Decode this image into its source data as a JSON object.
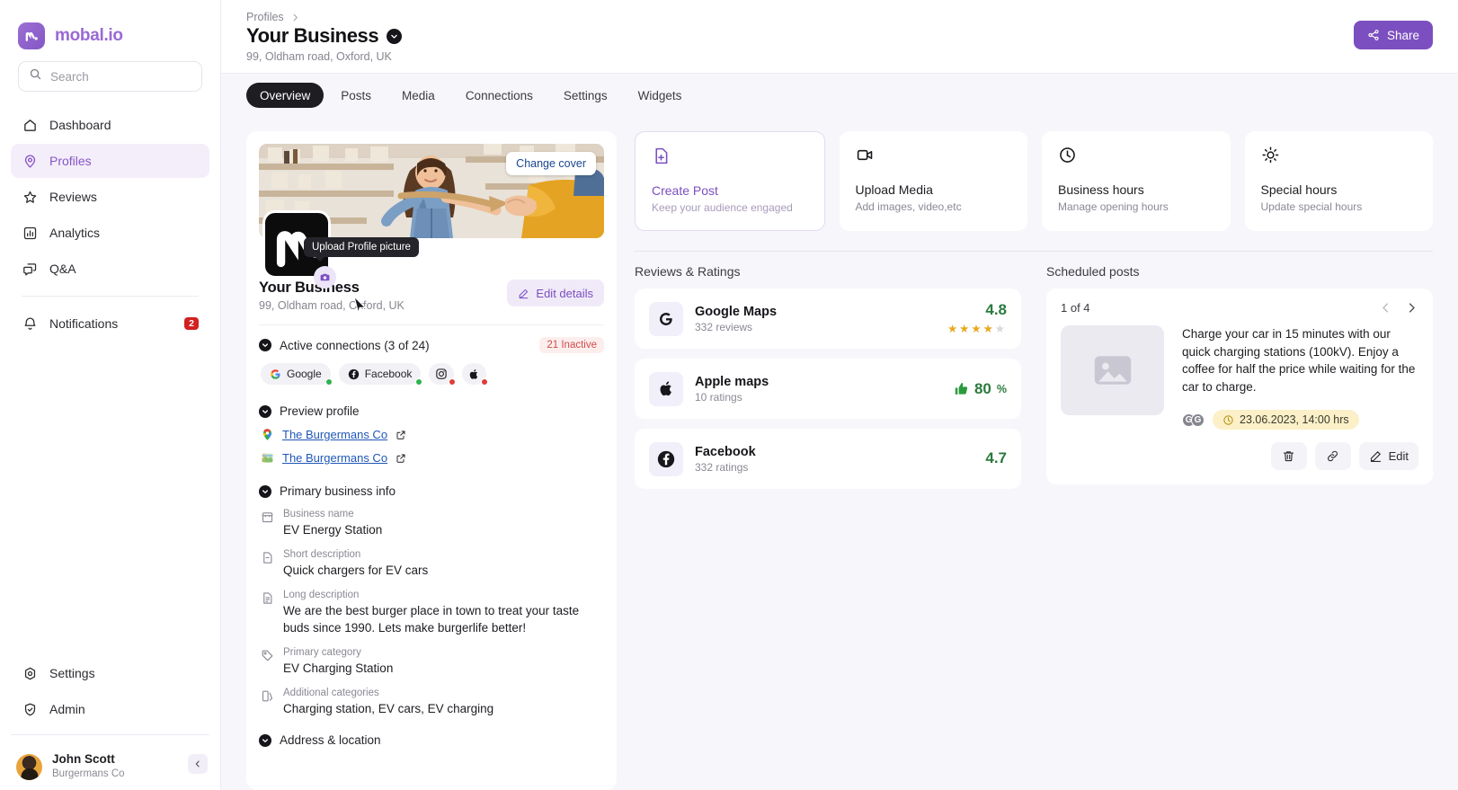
{
  "sidebar": {
    "brand": "mobal.io",
    "search_placeholder": "Search",
    "items": [
      {
        "label": "Dashboard",
        "icon": "home-icon"
      },
      {
        "label": "Profiles",
        "icon": "location-pin-icon"
      },
      {
        "label": "Reviews",
        "icon": "star-icon"
      },
      {
        "label": "Analytics",
        "icon": "bar-chart-icon"
      },
      {
        "label": "Q&A",
        "icon": "chat-icon"
      },
      {
        "label": "Notifications",
        "icon": "bell-icon",
        "badge": "2"
      }
    ],
    "bottom_items": [
      {
        "label": "Settings",
        "icon": "gear-icon"
      },
      {
        "label": "Admin",
        "icon": "shield-check-icon"
      }
    ],
    "user": {
      "name": "John Scott",
      "org": "Burgermans Co"
    }
  },
  "header": {
    "breadcrumb": "Profiles",
    "title": "Your Business",
    "subtitle": "99, Oldham road, Oxford, UK",
    "share_label": "Share"
  },
  "tabs": [
    {
      "label": "Overview",
      "active": true
    },
    {
      "label": "Posts",
      "active": false
    },
    {
      "label": "Media",
      "active": false
    },
    {
      "label": "Connections",
      "active": false
    },
    {
      "label": "Settings",
      "active": false
    },
    {
      "label": "Widgets",
      "active": false
    }
  ],
  "profile": {
    "change_cover_label": "Change cover",
    "upload_tooltip": "Upload Profile picture",
    "business_name": "Your Business",
    "address": "99, Oldham road, Oxford, UK",
    "edit_label": "Edit details",
    "connections": {
      "title": "Active connections (3 of 24)",
      "inactive_badge": "21 Inactive",
      "chips": [
        {
          "label": "Google",
          "icon": "google-icon",
          "status": "ok"
        },
        {
          "label": "Facebook",
          "icon": "facebook-icon",
          "status": "ok"
        },
        {
          "label": "",
          "icon": "instagram-icon",
          "status": "bad"
        },
        {
          "label": "",
          "icon": "apple-icon",
          "status": "bad"
        }
      ]
    },
    "preview": {
      "title": "Preview profile",
      "links": [
        {
          "label": "The Burgermans Co",
          "icon": "google-maps-pin-icon"
        },
        {
          "label": "The Burgermans Co",
          "icon": "apple-maps-icon"
        }
      ]
    },
    "primary_info": {
      "title": "Primary business info",
      "fields": [
        {
          "label": "Business name",
          "value": "EV Energy Station",
          "icon": "storefront-icon"
        },
        {
          "label": "Short description",
          "value": "Quick chargers for EV cars",
          "icon": "document-minus-icon"
        },
        {
          "label": "Long description",
          "value": "We are the best burger place in town to treat your taste buds since 1990. Lets make burgerlife better!",
          "icon": "document-lines-icon"
        },
        {
          "label": "Primary category",
          "value": "EV Charging Station",
          "icon": "tag-icon"
        },
        {
          "label": "Additional categories",
          "value": "Charging station, EV cars, EV charging",
          "icon": "categories-icon"
        }
      ]
    },
    "address_section": {
      "title": "Address & location"
    }
  },
  "quick_actions": [
    {
      "title": "Create Post",
      "subtitle": "Keep your audience engaged",
      "icon": "file-plus-icon",
      "primary": true
    },
    {
      "title": "Upload Media",
      "subtitle": "Add images, video,etc",
      "icon": "video-camera-icon",
      "primary": false
    },
    {
      "title": "Business hours",
      "subtitle": "Manage opening hours",
      "icon": "clock-icon",
      "primary": false
    },
    {
      "title": "Special hours",
      "subtitle": "Update special hours",
      "icon": "sun-icon",
      "primary": false
    }
  ],
  "reviews": {
    "title": "Reviews & Ratings",
    "items": [
      {
        "name": "Google Maps",
        "sub": "332 reviews",
        "score": "4.8",
        "type": "stars",
        "stars_filled": 4,
        "stars_total": 5,
        "icon": "google-icon"
      },
      {
        "name": "Apple maps",
        "sub": "10 ratings",
        "score": "80",
        "suffix": "%",
        "type": "thumbs",
        "icon": "apple-icon"
      },
      {
        "name": "Facebook",
        "sub": "332 ratings",
        "score": "4.7",
        "type": "number",
        "icon": "facebook-icon"
      }
    ]
  },
  "scheduled": {
    "title": "Scheduled posts",
    "counter": "1 of 4",
    "post_text": "Charge your car in 15 minutes with our quick charging stations (100kV). Enjoy a coffee for half the price while waiting for the car to charge.",
    "channels": [
      "G",
      "G"
    ],
    "time": "23.06.2023, 14:00 hrs",
    "actions": [
      {
        "label": "",
        "icon": "trash-icon"
      },
      {
        "label": "",
        "icon": "link-icon"
      },
      {
        "label": "Edit",
        "icon": "pencil-icon"
      }
    ]
  },
  "colors": {
    "brand_purple": "#9a68d6",
    "share_purple": "#7c4fc0",
    "green": "#2b7a3d",
    "star_gold": "#e7a81e",
    "badge_red": "#d32020",
    "link_blue": "#1f57b8"
  }
}
